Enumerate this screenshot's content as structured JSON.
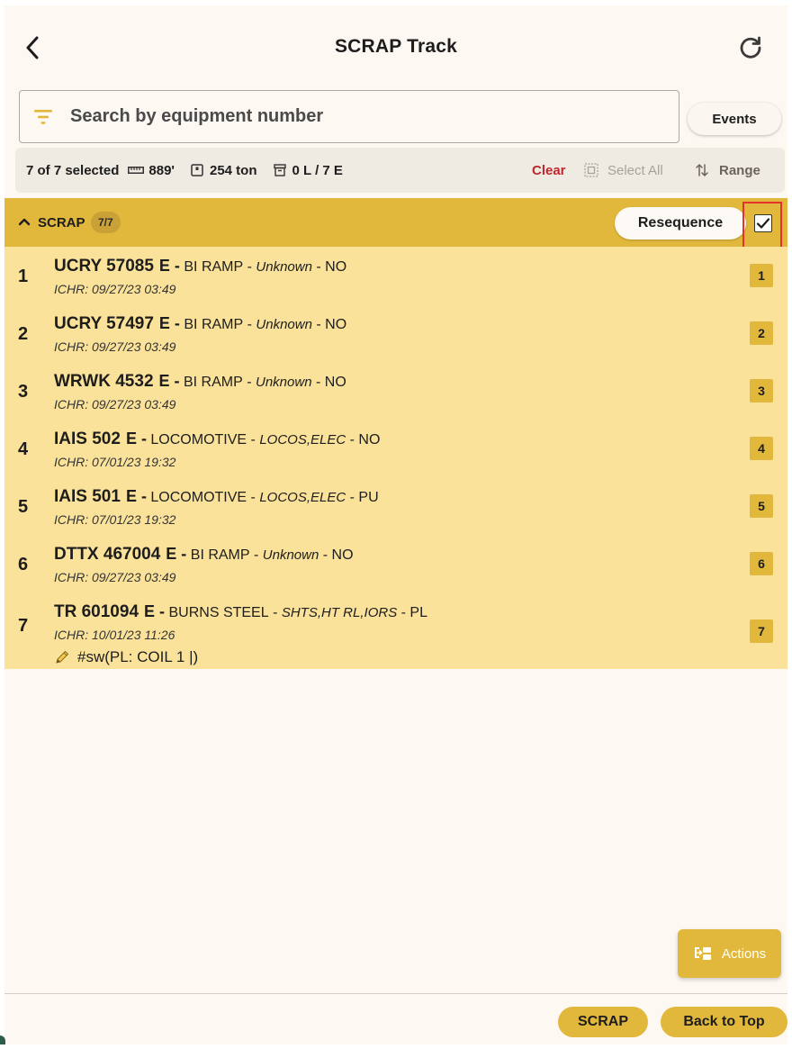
{
  "header": {
    "title": "SCRAP Track"
  },
  "search": {
    "placeholder": "Search by equipment number",
    "value": ""
  },
  "events_label": "Events",
  "summary": {
    "selected": "7 of 7 selected",
    "length": "889'",
    "weight": "254 ton",
    "loads_empties": "0 L / 7 E",
    "clear_label": "Clear",
    "select_all_label": "Select All",
    "range_label": "Range"
  },
  "group": {
    "name": "SCRAP",
    "count": "7/7",
    "resequence_label": "Resequence",
    "all_checked": true
  },
  "rows": [
    {
      "seq": "1",
      "equipment": "UCRY 57085",
      "le": "E -",
      "location": "BI RAMP",
      "commodity": "Unknown",
      "status": "NO",
      "ichr": "ICHR: 09/27/23 03:49",
      "badge": "1",
      "note": ""
    },
    {
      "seq": "2",
      "equipment": "UCRY 57497",
      "le": "E -",
      "location": "BI RAMP",
      "commodity": "Unknown",
      "status": "NO",
      "ichr": "ICHR: 09/27/23 03:49",
      "badge": "2",
      "note": ""
    },
    {
      "seq": "3",
      "equipment": "WRWK 4532",
      "le": "E -",
      "location": "BI RAMP",
      "commodity": "Unknown",
      "status": "NO",
      "ichr": "ICHR: 09/27/23 03:49",
      "badge": "3",
      "note": ""
    },
    {
      "seq": "4",
      "equipment": "IAIS 502",
      "le": "E -",
      "location": "LOCOMOTIVE",
      "commodity": "LOCOS,ELEC",
      "status": "NO",
      "ichr": "ICHR: 07/01/23 19:32",
      "badge": "4",
      "note": ""
    },
    {
      "seq": "5",
      "equipment": "IAIS 501",
      "le": "E -",
      "location": "LOCOMOTIVE",
      "commodity": "LOCOS,ELEC",
      "status": "PU",
      "ichr": "ICHR: 07/01/23 19:32",
      "badge": "5",
      "note": ""
    },
    {
      "seq": "6",
      "equipment": "DTTX 467004",
      "le": "E -",
      "location": "BI RAMP",
      "commodity": "Unknown",
      "status": "NO",
      "ichr": "ICHR: 09/27/23 03:49",
      "badge": "6",
      "note": ""
    },
    {
      "seq": "7",
      "equipment": "TR 601094",
      "le": "E -",
      "location": "BURNS STEEL",
      "commodity": "SHTS,HT RL,IORS",
      "status": "PL",
      "ichr": "ICHR: 10/01/23 11:26",
      "badge": "7",
      "note": "#sw(PL: COIL 1 |)"
    }
  ],
  "actions_label": "Actions",
  "footer": {
    "scrap_label": "SCRAP",
    "back_to_top_label": "Back to Top"
  },
  "colors": {
    "accent": "#e1b83c",
    "row_background": "#fae29a",
    "page_background": "#fdf8f2",
    "clear_red": "#c0272d",
    "highlight_red": "#e5322d"
  }
}
